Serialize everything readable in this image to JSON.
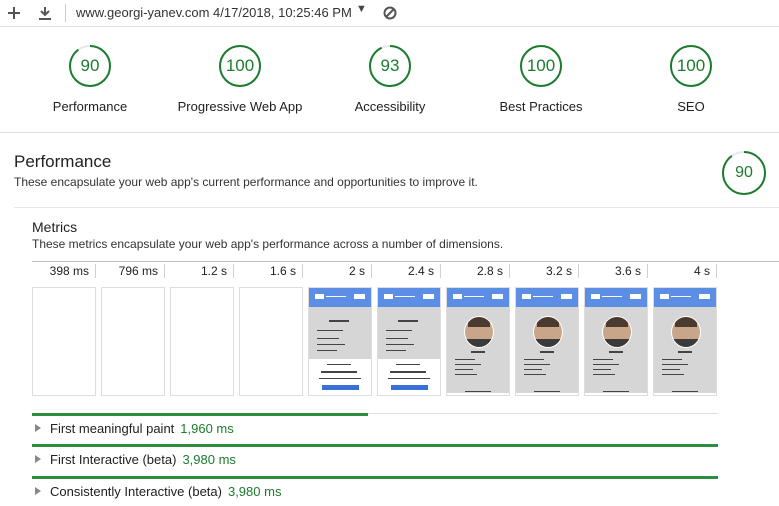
{
  "toolbar": {
    "url_text": "www.georgi-yanev.com 4/17/2018, 10:25:46 PM",
    "icons": [
      "plus-icon",
      "download-icon",
      "caret-down-icon",
      "block-icon"
    ]
  },
  "scores": [
    {
      "label": "Performance",
      "value": "90",
      "fraction": 0.9
    },
    {
      "label": "Progressive Web App",
      "value": "100",
      "fraction": 1.0
    },
    {
      "label": "Accessibility",
      "value": "93",
      "fraction": 0.93
    },
    {
      "label": "Best Practices",
      "value": "100",
      "fraction": 1.0
    },
    {
      "label": "SEO",
      "value": "100",
      "fraction": 1.0
    }
  ],
  "performance": {
    "title": "Performance",
    "description": "These encapsulate your web app's current performance and opportunities to improve it.",
    "score": "90",
    "score_fraction": 0.9,
    "metrics_title": "Metrics",
    "metrics_description": "These metrics encapsulate your web app's performance across a number of dimensions."
  },
  "filmstrip": [
    {
      "time": "398 ms",
      "state": "blank"
    },
    {
      "time": "796 ms",
      "state": "blank"
    },
    {
      "time": "1.2 s",
      "state": "blank"
    },
    {
      "time": "1.6 s",
      "state": "blank"
    },
    {
      "time": "2 s",
      "state": "partial"
    },
    {
      "time": "2.4 s",
      "state": "partial"
    },
    {
      "time": "2.8 s",
      "state": "full"
    },
    {
      "time": "3.2 s",
      "state": "full"
    },
    {
      "time": "3.6 s",
      "state": "full"
    },
    {
      "time": "4 s",
      "state": "full"
    }
  ],
  "metrics": [
    {
      "label": "First meaningful paint",
      "value": "1,960 ms",
      "fraction": 0.49
    },
    {
      "label": "First Interactive (beta)",
      "value": "3,980 ms",
      "fraction": 1.0
    },
    {
      "label": "Consistently Interactive (beta)",
      "value": "3,980 ms",
      "fraction": 1.0
    }
  ],
  "colors": {
    "pass": "#1b7c2e",
    "accent_blue": "#5c8ee6"
  }
}
